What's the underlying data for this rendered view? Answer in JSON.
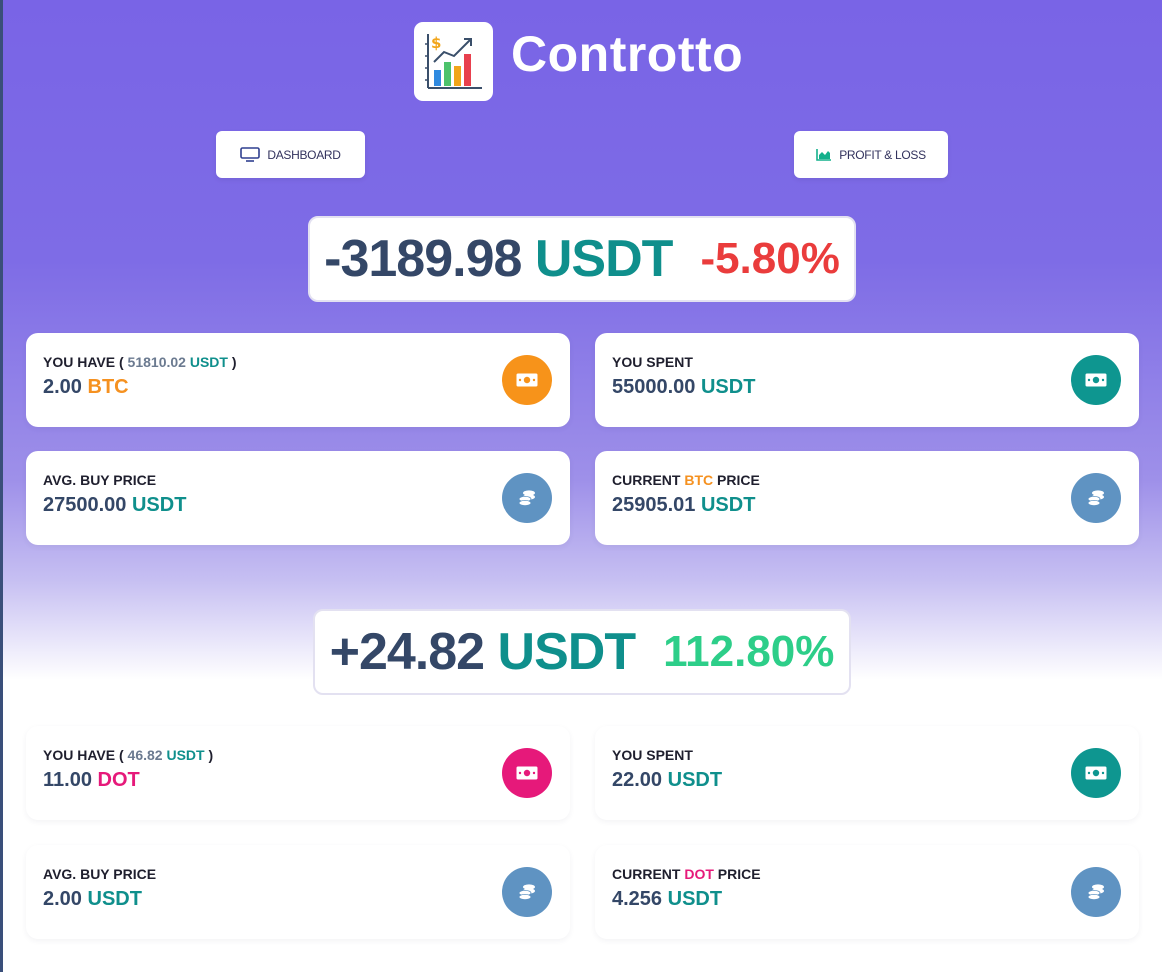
{
  "app": {
    "name": "Controtto"
  },
  "nav": {
    "dashboard_label": "DASHBOARD",
    "pnl_label": "PROFIT & LOSS"
  },
  "colors": {
    "usdt": "#0f8f8c",
    "btc": "#f59120",
    "dot": "#e6197a",
    "loss": "#ea3c3c",
    "gain": "#2dce89",
    "background_top": "#7964e6"
  },
  "icons": {
    "logo": "bar-chart-dollar-icon",
    "dashboard": "monitor-icon",
    "pnl": "area-chart-icon",
    "you_have": "money-bill-icon",
    "you_spent": "money-bill-icon",
    "avg_price": "coins-icon",
    "current_price": "coins-icon"
  },
  "portfolios": [
    {
      "asset": "BTC",
      "pnl": {
        "amount": "-3189.98",
        "unit": "USDT",
        "percent": "-5.80%"
      },
      "you_have": {
        "label": "YOU HAVE",
        "worth": "51810.02",
        "worth_unit": "USDT",
        "amount": "2.00",
        "asset": "BTC"
      },
      "you_spent": {
        "label": "YOU SPENT",
        "amount": "55000.00",
        "unit": "USDT"
      },
      "avg_buy": {
        "label": "AVG. BUY PRICE",
        "amount": "27500.00",
        "unit": "USDT"
      },
      "current": {
        "label_prefix": "CURRENT",
        "asset": "BTC",
        "label_suffix": "PRICE",
        "amount": "25905.01",
        "unit": "USDT"
      }
    },
    {
      "asset": "DOT",
      "pnl": {
        "amount": "+24.82",
        "unit": "USDT",
        "percent": "112.80%"
      },
      "you_have": {
        "label": "YOU HAVE",
        "worth": "46.82",
        "worth_unit": "USDT",
        "amount": "11.00",
        "asset": "DOT"
      },
      "you_spent": {
        "label": "YOU SPENT",
        "amount": "22.00",
        "unit": "USDT"
      },
      "avg_buy": {
        "label": "AVG. BUY PRICE",
        "amount": "2.00",
        "unit": "USDT"
      },
      "current": {
        "label_prefix": "CURRENT",
        "asset": "DOT",
        "label_suffix": "PRICE",
        "amount": "4.256",
        "unit": "USDT"
      }
    }
  ]
}
